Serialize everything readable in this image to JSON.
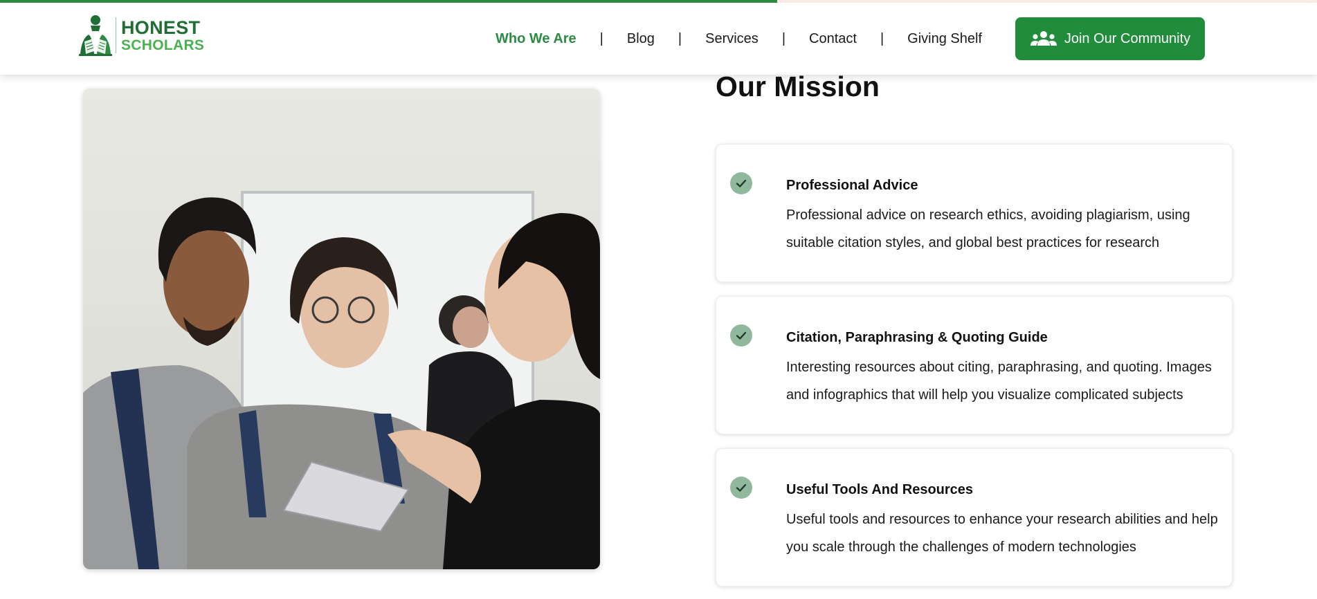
{
  "page_progress_percent": 59,
  "colors": {
    "brand_green": "#2e8b43",
    "brand_dark_green": "#1f6e34",
    "brand_light_green": "#4caf50",
    "cta_green": "#218c3b",
    "check_badge": "#8fb89c"
  },
  "header": {
    "logo": {
      "line1": "HONEST",
      "line2": "SCHOLARS",
      "icon": "scholar-book-logo"
    },
    "nav": {
      "items": [
        {
          "label": "Who We Are",
          "active": true
        },
        {
          "label": "Blog",
          "active": false
        },
        {
          "label": "Services",
          "active": false
        },
        {
          "label": "Contact",
          "active": false
        },
        {
          "label": "Giving Shelf",
          "active": false
        }
      ],
      "separator": "|"
    },
    "cta": {
      "label": "Join Our Community",
      "icon": "users-group-icon"
    }
  },
  "hero_image": {
    "subject": "students-discussion-photo"
  },
  "mission": {
    "title": "Our Mission",
    "check_icon": "check-circle-icon",
    "items": [
      {
        "title": "Professional Advice",
        "description": "Professional advice on research ethics, avoiding plagiarism, using suitable citation styles, and global best practices for research"
      },
      {
        "title": "Citation, Paraphrasing & Quoting Guide",
        "description": "Interesting resources about citing, paraphrasing, and quoting. Images and infographics that will help you visualize complicated subjects"
      },
      {
        "title": "Useful Tools And Resources",
        "description": "Useful tools and resources to enhance your research abilities and help you scale through the challenges of modern technologies"
      }
    ]
  }
}
